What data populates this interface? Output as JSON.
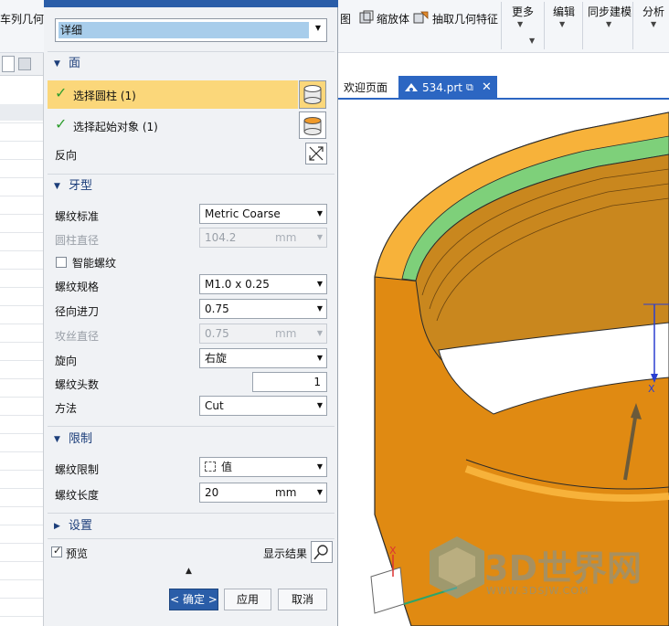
{
  "ribbon": {
    "top_left": "车列几何特",
    "item_a": "图",
    "item_a_label": "缩放体",
    "item_b_label": "抽取几何特征",
    "more": "更多",
    "edit": "编辑",
    "sync": "同步建模",
    "analysis": "分析"
  },
  "viewport": {
    "tab_welcome": "欢迎页面",
    "tab_part": "534.prt",
    "axis_x": "X",
    "watermark_logo": "3D世界网",
    "watermark_url": "WWW.3DSJW.COM",
    "colors": {
      "body": "#e08a12",
      "rim": "#f7b23a",
      "inner": "#c9871e",
      "green_band": "#7ed07a"
    }
  },
  "dialog": {
    "mode_value": "详细",
    "face": {
      "title": "面",
      "select_cylinder": "选择圆柱 (1)",
      "select_start": "选择起始对象 (1)",
      "reverse": "反向"
    },
    "thread_type": {
      "title": "牙型",
      "standard_label": "螺纹标准",
      "standard_value": "Metric Coarse",
      "cyl_diameter_label": "圆柱直径",
      "cyl_diameter_value": "104.2",
      "cyl_diameter_unit": "mm",
      "smart_thread": "智能螺纹",
      "spec_label": "螺纹规格",
      "spec_value": "M1.0 x 0.25",
      "radial_feed_label": "径向进刀",
      "radial_feed_value": "0.75",
      "tap_diameter_label": "攻丝直径",
      "tap_diameter_value": "0.75",
      "tap_diameter_unit": "mm",
      "hand_label": "旋向",
      "hand_value": "右旋",
      "starts_label": "螺纹头数",
      "starts_value": "1",
      "method_label": "方法",
      "method_value": "Cut"
    },
    "limits": {
      "title": "限制",
      "limit_label": "螺纹限制",
      "limit_value": "值",
      "length_label": "螺纹长度",
      "length_value": "20",
      "length_unit": "mm"
    },
    "settings": {
      "title": "设置"
    },
    "preview_label": "预览",
    "show_result": "显示结果",
    "ok": "< 确定 >",
    "apply": "应用",
    "cancel": "取消",
    "colors": {
      "highlight": "#fbd77a",
      "check": "#2e9e2e",
      "accent": "#2a5da8"
    }
  }
}
